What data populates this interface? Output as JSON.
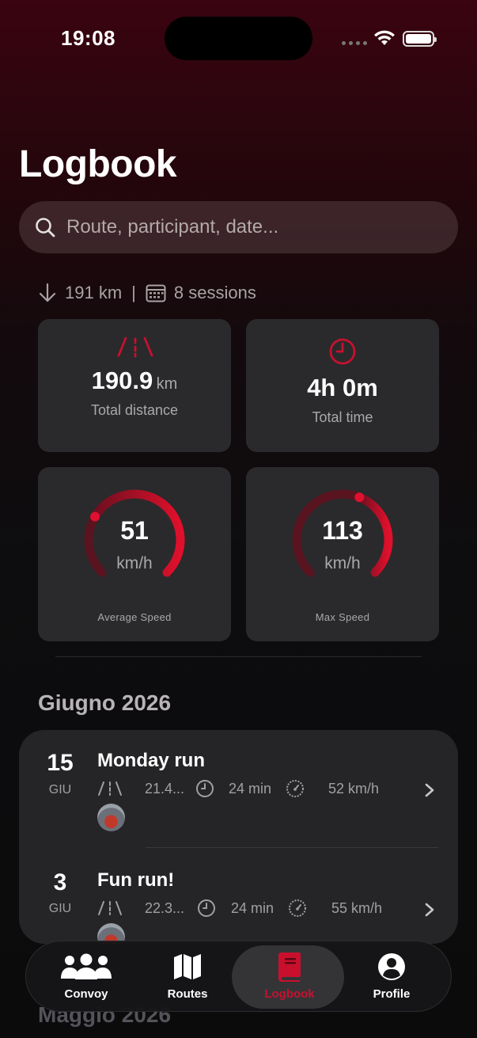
{
  "status_bar": {
    "time": "19:08"
  },
  "header": {
    "title": "Logbook"
  },
  "search": {
    "placeholder": "Route, participant, date..."
  },
  "summary": {
    "distance": "191 km",
    "separator": "|",
    "sessions": "8 sessions"
  },
  "stats": {
    "total_distance": {
      "value": "190.9",
      "unit": "km",
      "label": "Total distance"
    },
    "total_time": {
      "value": "4h 0m",
      "label": "Total time"
    },
    "average_speed": {
      "value": "51",
      "unit": "km/h",
      "label": "Average Speed",
      "gauge_fraction": 0.28
    },
    "max_speed": {
      "value": "113",
      "unit": "km/h",
      "label": "Max Speed",
      "gauge_fraction": 0.58
    }
  },
  "sections": [
    {
      "title": "Giugno 2026",
      "entries": [
        {
          "day": "15",
          "month": "GIU",
          "title": "Monday run",
          "distance": "21.4...",
          "duration": "24 min",
          "speed": "52 km/h"
        },
        {
          "day": "3",
          "month": "GIU",
          "title": "Fun run!",
          "distance": "22.3...",
          "duration": "24 min",
          "speed": "55 km/h"
        }
      ]
    },
    {
      "title": "Maggio 2026"
    }
  ],
  "tab_bar": {
    "tabs": [
      {
        "label": "Convoy",
        "icon": "people-icon"
      },
      {
        "label": "Routes",
        "icon": "map-icon"
      },
      {
        "label": "Logbook",
        "icon": "book-icon",
        "active": true
      },
      {
        "label": "Profile",
        "icon": "person-icon"
      }
    ]
  },
  "colors": {
    "accent": "#c8102e",
    "card": "#2a2a2c",
    "muted": "#a9a9ac"
  }
}
